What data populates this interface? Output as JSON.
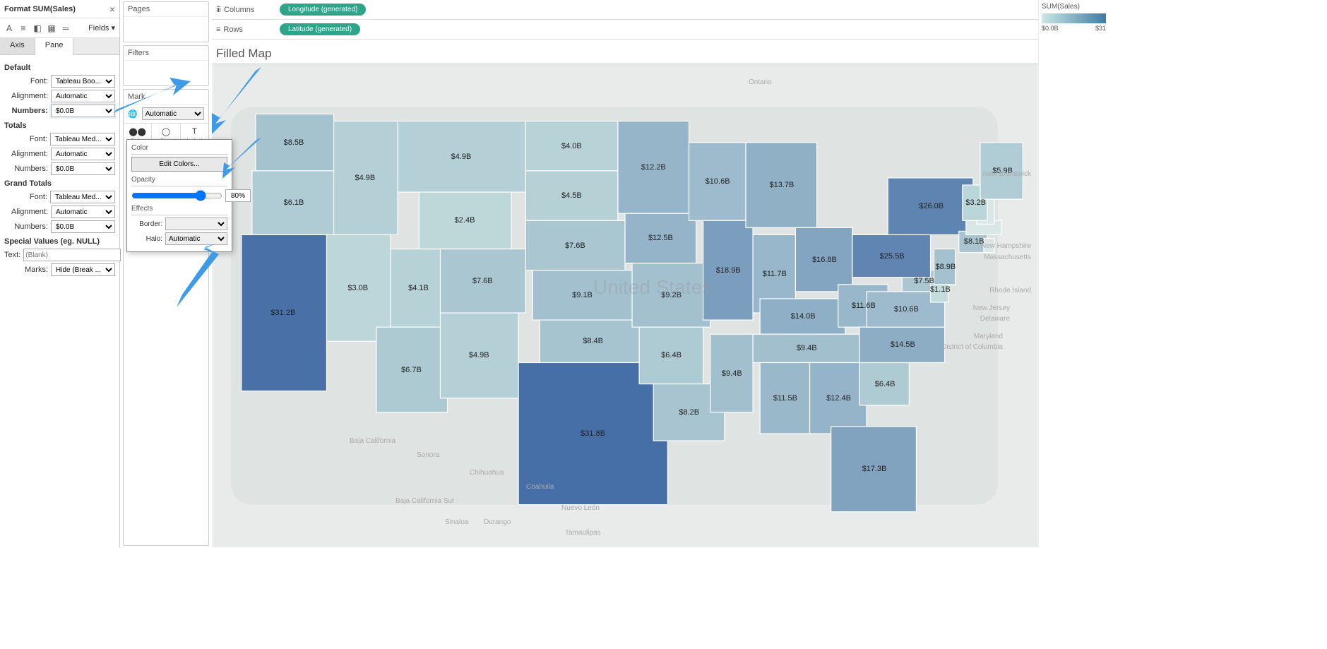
{
  "format_panel": {
    "title": "Format SUM(Sales)",
    "fields_label": "Fields ▾",
    "tabs": {
      "axis": "Axis",
      "pane": "Pane"
    },
    "default": {
      "heading": "Default",
      "font_label": "Font:",
      "font_value": "Tableau Boo...",
      "align_label": "Alignment:",
      "align_value": "Automatic",
      "numbers_label": "Numbers:",
      "numbers_value": "$0.0B"
    },
    "totals": {
      "heading": "Totals",
      "font_label": "Font:",
      "font_value": "Tableau Med...",
      "align_label": "Alignment:",
      "align_value": "Automatic",
      "numbers_label": "Numbers:",
      "numbers_value": "$0.0B"
    },
    "grand_totals": {
      "heading": "Grand Totals",
      "font_label": "Font:",
      "font_value": "Tableau Med...",
      "align_label": "Alignment:",
      "align_value": "Automatic",
      "numbers_label": "Numbers:",
      "numbers_value": "$0.0B"
    },
    "special": {
      "heading": "Special Values (eg. NULL)",
      "text_label": "Text:",
      "text_placeholder": "(Blank)",
      "marks_label": "Marks:",
      "marks_value": "Hide (Break ..."
    }
  },
  "cards": {
    "pages": "Pages",
    "filters": "Filters",
    "marks": "Mark",
    "mark_type": "Automatic",
    "color": "Color",
    "size": "Size",
    "label": "Label"
  },
  "color_popup": {
    "color_label": "Color",
    "edit_colors": "Edit Colors...",
    "opacity_label": "Opacity",
    "opacity_value": "80%",
    "effects_label": "Effects",
    "border_label": "Border:",
    "border_value": "",
    "halo_label": "Halo:",
    "halo_value": "Automatic"
  },
  "shelves": {
    "columns_label": "Columns",
    "rows_label": "Rows",
    "columns_pill": "Longitude (generated)",
    "rows_pill": "Latitude (generated)"
  },
  "viz": {
    "title": "Filled Map"
  },
  "legend": {
    "title": "SUM(Sales)",
    "min": "$0.0B",
    "max": "$31"
  },
  "chart_data": {
    "type": "choropleth",
    "title": "Filled Map",
    "color_field": "SUM(Sales)",
    "color_range": [
      0.0,
      31.8
    ],
    "color_unit": "$B",
    "states": [
      {
        "state": "Washington",
        "label": "$8.5B",
        "value": 8.5
      },
      {
        "state": "Oregon",
        "label": "$6.1B",
        "value": 6.1
      },
      {
        "state": "California",
        "label": "$31.2B",
        "value": 31.2
      },
      {
        "state": "Idaho",
        "label": "$4.9B",
        "value": 4.9
      },
      {
        "state": "Montana",
        "label": "$4.9B",
        "value": 4.9
      },
      {
        "state": "Nevada",
        "label": "$3.0B",
        "value": 3.0
      },
      {
        "state": "Utah",
        "label": "$4.1B",
        "value": 4.1
      },
      {
        "state": "Arizona",
        "label": "$6.7B",
        "value": 6.7
      },
      {
        "state": "Wyoming",
        "label": "$2.4B",
        "value": 2.4
      },
      {
        "state": "Colorado",
        "label": "$7.6B",
        "value": 7.6
      },
      {
        "state": "New Mexico",
        "label": "$4.9B",
        "value": 4.9
      },
      {
        "state": "North Dakota",
        "label": "$4.0B",
        "value": 4.0
      },
      {
        "state": "South Dakota",
        "label": "$4.5B",
        "value": 4.5
      },
      {
        "state": "Nebraska",
        "label": "$7.6B",
        "value": 7.6
      },
      {
        "state": "Kansas",
        "label": "$9.1B",
        "value": 9.1
      },
      {
        "state": "Oklahoma",
        "label": "$8.4B",
        "value": 8.4
      },
      {
        "state": "Texas",
        "label": "$31.8B",
        "value": 31.8
      },
      {
        "state": "Minnesota",
        "label": "$12.2B",
        "value": 12.2
      },
      {
        "state": "Iowa",
        "label": "$12.5B",
        "value": 12.5
      },
      {
        "state": "Missouri",
        "label": "$9.2B",
        "value": 9.2
      },
      {
        "state": "Arkansas",
        "label": "$6.4B",
        "value": 6.4
      },
      {
        "state": "Louisiana",
        "label": "$8.2B",
        "value": 8.2
      },
      {
        "state": "Wisconsin",
        "label": "$10.6B",
        "value": 10.6
      },
      {
        "state": "Illinois",
        "label": "$18.9B",
        "value": 18.9
      },
      {
        "state": "Mississippi",
        "label": "$9.4B",
        "value": 9.4
      },
      {
        "state": "Michigan",
        "label": "$13.7B",
        "value": 13.7
      },
      {
        "state": "Indiana",
        "label": "$11.7B",
        "value": 11.7
      },
      {
        "state": "Kentucky",
        "label": "$14.0B",
        "value": 14.0
      },
      {
        "state": "Tennessee",
        "label": "$9.4B",
        "value": 9.4
      },
      {
        "state": "Alabama",
        "label": "$11.5B",
        "value": 11.5
      },
      {
        "state": "Ohio",
        "label": "$16.8B",
        "value": 16.8
      },
      {
        "state": "West Virginia",
        "label": "$11.6B",
        "value": 11.6
      },
      {
        "state": "Georgia",
        "label": "$12.4B",
        "value": 12.4
      },
      {
        "state": "Florida",
        "label": "$17.3B",
        "value": 17.3
      },
      {
        "state": "South Carolina",
        "label": "$6.4B",
        "value": 6.4
      },
      {
        "state": "North Carolina",
        "label": "$14.5B",
        "value": 14.5
      },
      {
        "state": "Virginia",
        "label": "$10.6B",
        "value": 10.6
      },
      {
        "state": "Maryland",
        "label": "$7.5B",
        "value": 7.5
      },
      {
        "state": "Delaware",
        "label": "$1.1B",
        "value": 1.1
      },
      {
        "state": "Pennsylvania",
        "label": "$25.5B",
        "value": 25.5
      },
      {
        "state": "New York",
        "label": "$26.0B",
        "value": 26.0
      },
      {
        "state": "New Jersey",
        "label": "$8.9B",
        "value": 8.9
      },
      {
        "state": "Connecticut",
        "label": "$8.1B",
        "value": 8.1
      },
      {
        "state": "Massachusetts",
        "label": "",
        "value": null
      },
      {
        "state": "Rhode Island",
        "label": "",
        "value": null
      },
      {
        "state": "New Hampshire",
        "label": "",
        "value": null
      },
      {
        "state": "Vermont",
        "label": "$3.2B",
        "value": 3.2
      },
      {
        "state": "Maine",
        "label": "$5.9B",
        "value": 5.9
      }
    ],
    "background_labels": [
      "Ontario",
      "New Brunswick",
      "New Hampshire",
      "Massachusetts",
      "Rhode Island",
      "New Jersey",
      "Delaware",
      "Maryland",
      "District of Columbia",
      "Baja California",
      "Sonora",
      "Baja California Sur",
      "Chihuahua",
      "Coahuila",
      "Nuevo León",
      "Durango",
      "Sinaloa",
      "Tamaulipas",
      "United States"
    ]
  }
}
